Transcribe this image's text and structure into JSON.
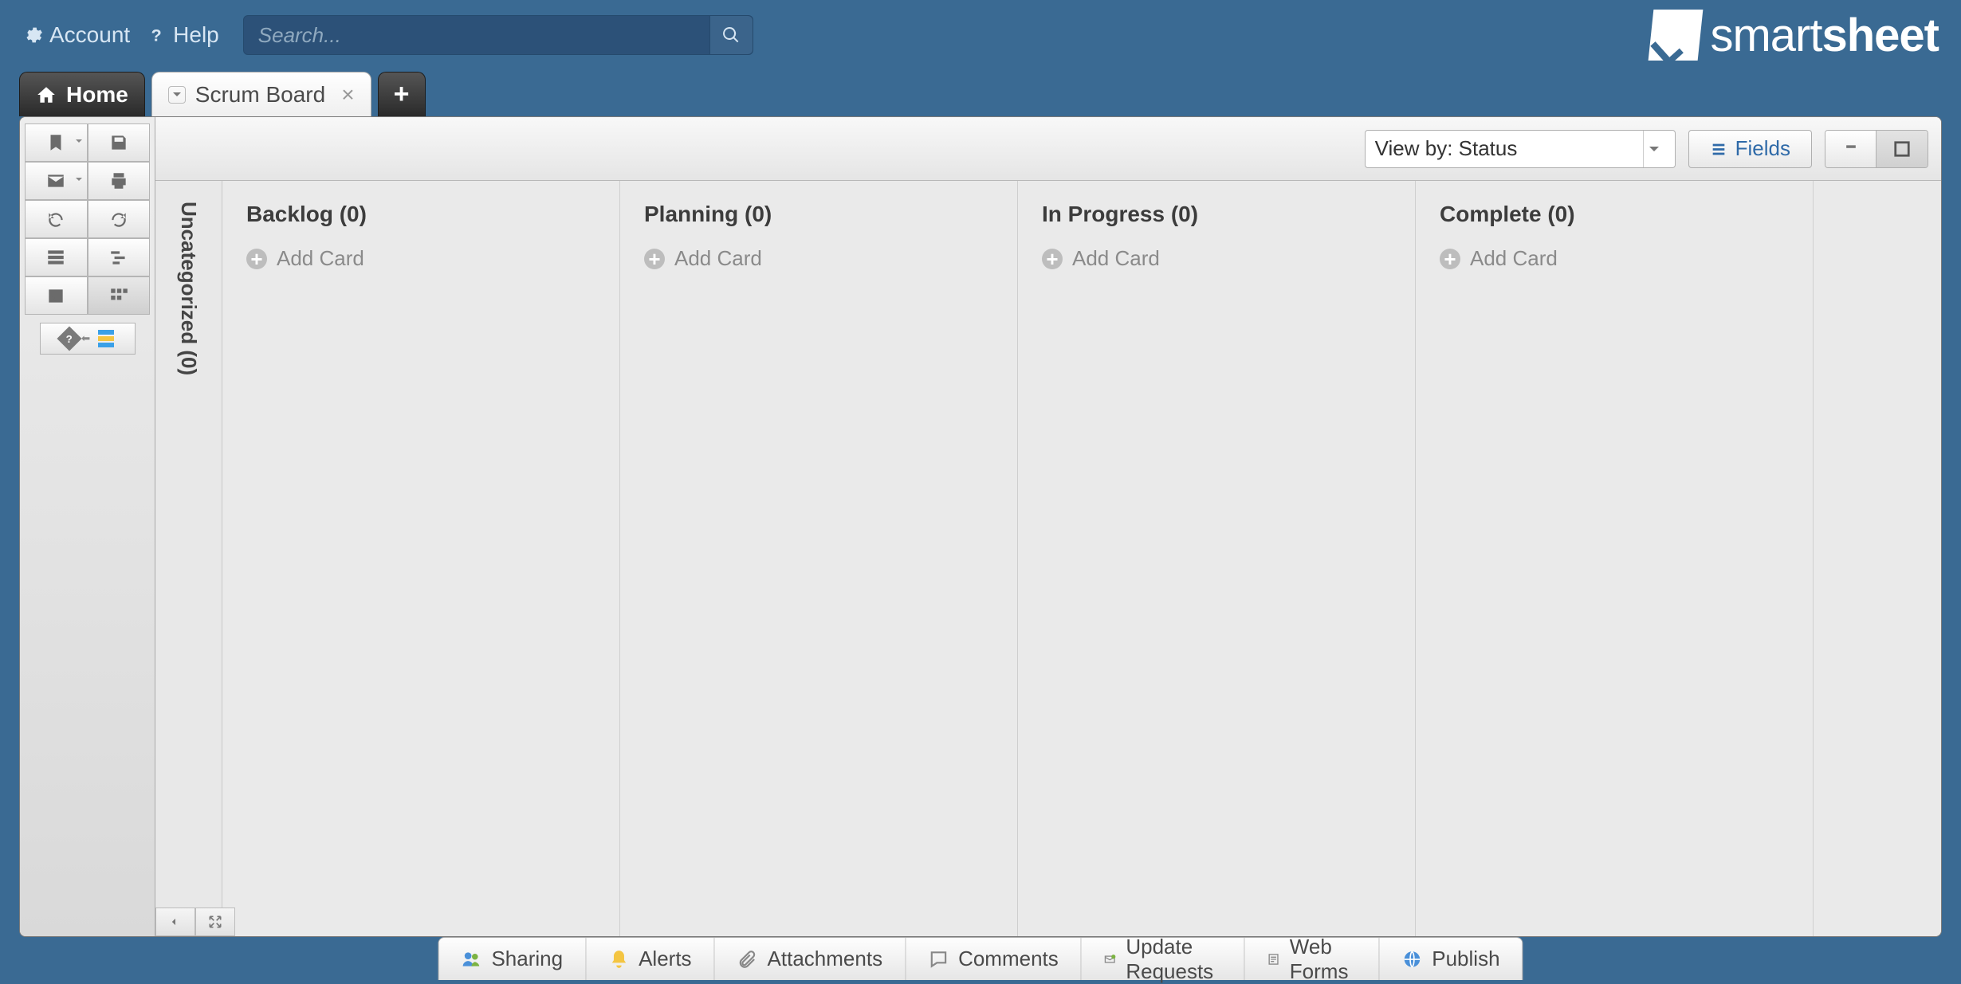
{
  "header": {
    "account_label": "Account",
    "help_label": "Help",
    "search_placeholder": "Search...",
    "brand_light": "smart",
    "brand_bold": "sheet"
  },
  "tabs": {
    "home_label": "Home",
    "active_label": "Scrum Board"
  },
  "viewbar": {
    "view_by_label": "View by: Status",
    "fields_label": "Fields"
  },
  "board": {
    "uncategorized_label": "Uncategorized (0)",
    "add_card_label": "Add Card",
    "lanes": [
      {
        "title": "Backlog (0)"
      },
      {
        "title": "Planning (0)"
      },
      {
        "title": "In Progress (0)"
      },
      {
        "title": "Complete (0)"
      }
    ]
  },
  "bottom": {
    "sharing": "Sharing",
    "alerts": "Alerts",
    "attachments": "Attachments",
    "comments": "Comments",
    "update_requests": "Update Requests",
    "web_forms": "Web Forms",
    "publish": "Publish"
  }
}
